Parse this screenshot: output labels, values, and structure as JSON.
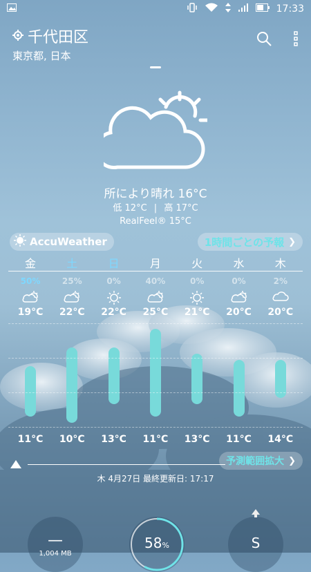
{
  "status_bar": {
    "time": "17:33"
  },
  "location": {
    "city": "千代田区",
    "region": "東京都, 日本"
  },
  "current": {
    "condition": "所により晴れ 16°C",
    "low_label": "低",
    "low": "12°C",
    "high_label": "高",
    "high": "17°C",
    "realfeel": "RealFeel® 15°C"
  },
  "brand": {
    "name": "AccuWeather"
  },
  "hourly_link": "1時間ごとの予報",
  "forecast": [
    {
      "day": "金",
      "precip": "50%",
      "icon": "partly-sunny-icon",
      "high": "19°C",
      "low": "11°C",
      "high_val": 19,
      "low_val": 11,
      "highlight_precip": true
    },
    {
      "day": "土",
      "precip": "25%",
      "icon": "partly-sunny-icon",
      "high": "22°C",
      "low": "10°C",
      "high_val": 22,
      "low_val": 10,
      "weekend": true
    },
    {
      "day": "日",
      "precip": "0%",
      "icon": "sunny-icon",
      "high": "22°C",
      "low": "13°C",
      "high_val": 22,
      "low_val": 13,
      "weekend": true
    },
    {
      "day": "月",
      "precip": "40%",
      "icon": "partly-sunny-icon",
      "high": "25°C",
      "low": "11°C",
      "high_val": 25,
      "low_val": 11
    },
    {
      "day": "火",
      "precip": "0%",
      "icon": "sunny-icon",
      "high": "21°C",
      "low": "13°C",
      "high_val": 21,
      "low_val": 13
    },
    {
      "day": "水",
      "precip": "0%",
      "icon": "partly-sunny-icon",
      "high": "20°C",
      "low": "11°C",
      "high_val": 20,
      "low_val": 11
    },
    {
      "day": "木",
      "precip": "2%",
      "icon": "cloudy-icon",
      "high": "20°C",
      "low": "14°C",
      "high_val": 20,
      "low_val": 14
    }
  ],
  "expand_link": "予測範囲拡大",
  "updated": "木 4月27日 最終更新日: 17:17",
  "pressure": {
    "value": "1,004 MB"
  },
  "humidity": {
    "value": "58",
    "unit": "%",
    "fraction": 0.58
  },
  "wind": {
    "direction": "S"
  },
  "colors": {
    "accent": "#6fe3e8",
    "bar": "#78dada",
    "weekend": "#7fd8ff"
  }
}
